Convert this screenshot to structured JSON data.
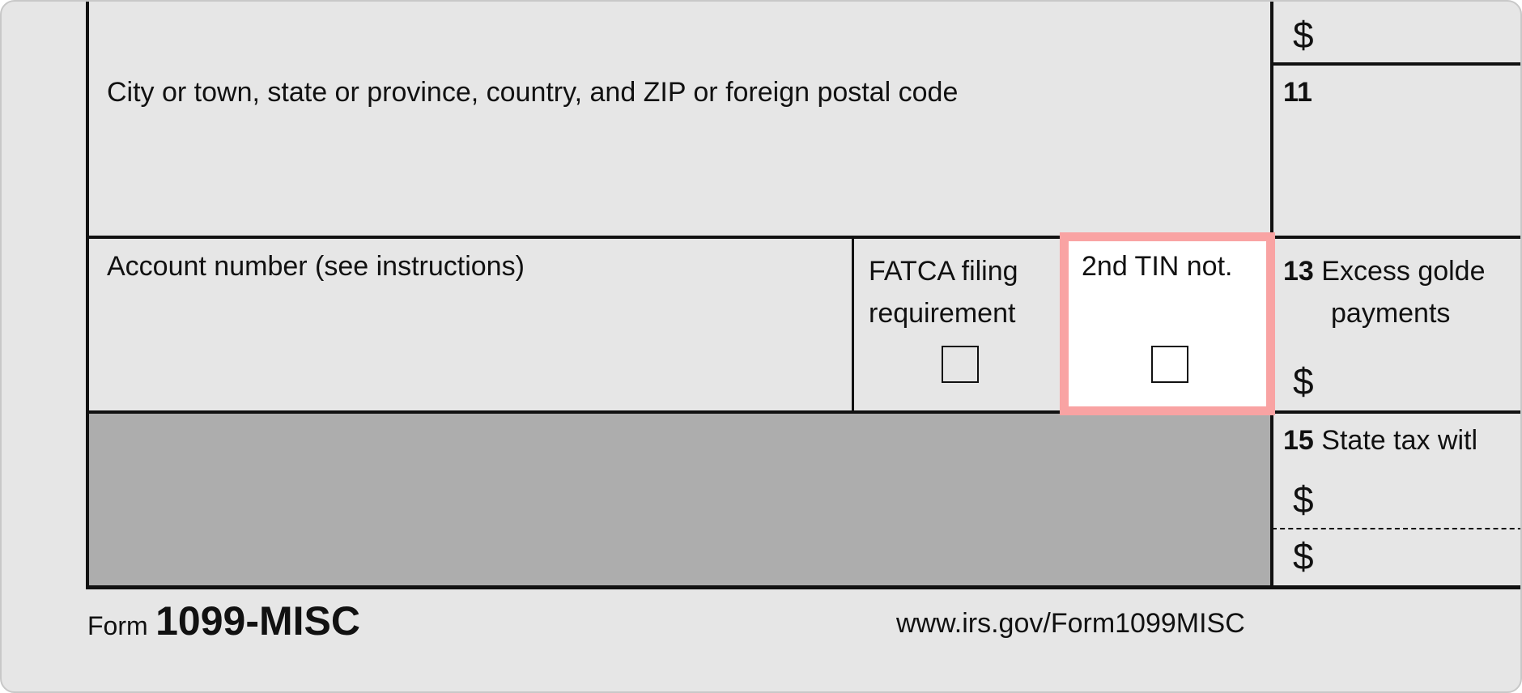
{
  "form": {
    "city_label": "City or town, state or province, country, and ZIP or foreign postal code",
    "box11_number": "11",
    "account_label": "Account number (see instructions)",
    "fatca_label_line1": "FATCA filing",
    "fatca_label_line2": "requirement",
    "tin_label": "2nd TIN not.",
    "box13_number": "13",
    "box13_label_line1": "Excess golde",
    "box13_label_line2": "payments",
    "box15_number": "15",
    "box15_label": "State tax witl",
    "currency_symbol": "$",
    "form_prefix": "Form",
    "form_name": "1099-MISC",
    "url": "www.irs.gov/Form1099MISC"
  },
  "fatca_checked": false,
  "tin_checked": false,
  "colors": {
    "highlight": "#f9a3a3",
    "shaded": "#adadad",
    "background": "#e6e6e6"
  }
}
